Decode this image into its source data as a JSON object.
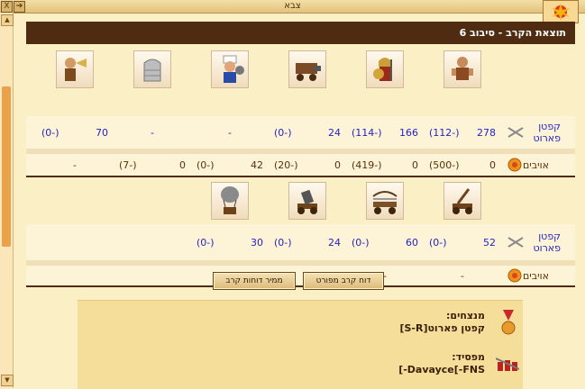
{
  "window": {
    "title": "צבא",
    "close_glyph": "X",
    "expand_glyph": "➔"
  },
  "panel": {
    "header": "תוצאת הקרב - סיבוב 6",
    "attacker_label": "קפטן פארוט",
    "enemy_label": "אויבים"
  },
  "row1": {
    "units": [
      {
        "icon": "brawler-icon"
      },
      {
        "icon": "spartan-icon"
      },
      {
        "icon": "ram-icon"
      },
      {
        "icon": "chef-icon"
      },
      {
        "icon": "wall-icon"
      },
      {
        "icon": "trumpeter-icon"
      }
    ],
    "attacker_values": [
      {
        "count": "278",
        "loss": "(112-)"
      },
      {
        "count": "166",
        "loss": "(114-)"
      },
      {
        "count": "24",
        "loss": "(0-)"
      },
      {
        "count": "-",
        "loss": ""
      },
      {
        "count": "-",
        "loss": ""
      },
      {
        "count": "70",
        "loss": "(0-)"
      }
    ],
    "enemy_values": [
      {
        "count": "0",
        "loss": "(500-)"
      },
      {
        "count": "0",
        "loss": "(419-)"
      },
      {
        "count": "0",
        "loss": "(20-)"
      },
      {
        "count": "42",
        "loss": "(0-)"
      },
      {
        "count": "0",
        "loss": "(7-)"
      },
      {
        "count": "-",
        "loss": ""
      }
    ]
  },
  "row2": {
    "units": [
      {
        "icon": "catapult-icon"
      },
      {
        "icon": "ballista-icon"
      },
      {
        "icon": "mortar-icon"
      },
      {
        "icon": "balloon-icon"
      }
    ],
    "attacker_values": [
      {
        "count": "52",
        "loss": "(0-)"
      },
      {
        "count": "60",
        "loss": "(0-)"
      },
      {
        "count": "24",
        "loss": "(0-)"
      },
      {
        "count": "30",
        "loss": "(0-)"
      }
    ],
    "enemy_values": [
      "-",
      "-",
      "-",
      "-"
    ]
  },
  "buttons": {
    "detailed": "דוח קרב מפורט",
    "convert": "ממיר דוחות קרב"
  },
  "summary": {
    "winners_label": "מנצחים:",
    "winners_name": "קפטן פארוט[S-R]",
    "loser_label": "מפסיד:",
    "loser_name": "[-Davayce[-FNS"
  },
  "colors": {
    "header_bg": "#4e2b11",
    "link_blue": "#2424c4",
    "panel_bg": "#fbefc6"
  }
}
